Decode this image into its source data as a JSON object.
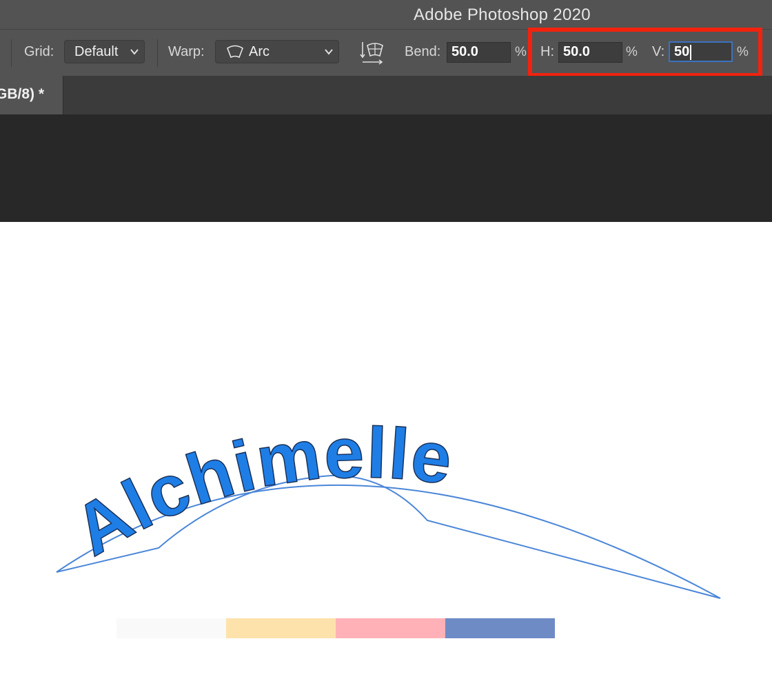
{
  "window": {
    "title": "Adobe Photoshop 2020"
  },
  "options_bar": {
    "grid_label": "Grid:",
    "grid_value": "Default",
    "warp_label": "Warp:",
    "warp_value": "Arc",
    "warp_orientation_icon": "warp-orientation-icon",
    "bend_label": "Bend:",
    "bend_value": "50.0",
    "bend_unit": "%",
    "h_label": "H:",
    "h_value": "50.0",
    "h_unit": "%",
    "v_label": "V:",
    "v_value": "50",
    "v_unit": "%"
  },
  "document_tab": {
    "label": "GB/8) *"
  },
  "canvas": {
    "warped_text": "Alchimelle",
    "swatches": [
      "#f9f9f9",
      "#fde2ab",
      "#ffb1b7",
      "#6e8bc6"
    ]
  },
  "colors": {
    "ui_panel": "#535353",
    "workspace": "#282828",
    "highlight": "#f2220e",
    "warp_blue": "#1e7ee6"
  }
}
